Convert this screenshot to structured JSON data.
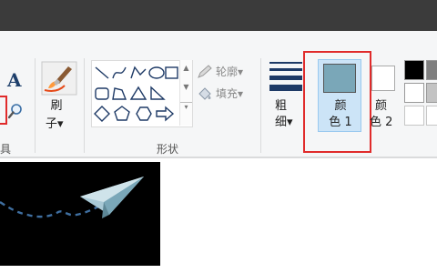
{
  "ribbon": {
    "tools_group_label": "具",
    "text_tool_glyph": "A",
    "brush": {
      "label_line1": "刷",
      "label_line2": "子▾"
    },
    "shapes": {
      "group_label": "形状",
      "outline_label": "轮廓▾",
      "fill_label": "填充▾"
    },
    "width": {
      "label_line1": "粗",
      "label_line2": "细▾"
    },
    "color1": {
      "label_line1": "颜",
      "label_line2": "色 1",
      "color": "#7aa7b8"
    },
    "color2": {
      "label_line1": "颜",
      "label_line2": "色 2",
      "color": "#ffffff"
    },
    "palette": {
      "rows": [
        [
          "#000000",
          "#7f7f7f"
        ],
        [
          "#ffffff",
          "#c3c3c3"
        ],
        [
          "#ffffff",
          "#ffffff"
        ]
      ]
    }
  },
  "icons": {
    "magnifier": "magnifier-icon",
    "brush": "brush-icon",
    "paper_plane": "paper-plane-icon"
  },
  "colors": {
    "highlight_box": "#e02b2b",
    "ribbon_bg": "#f5f6f7",
    "title_bar": "#3b3b3b"
  }
}
